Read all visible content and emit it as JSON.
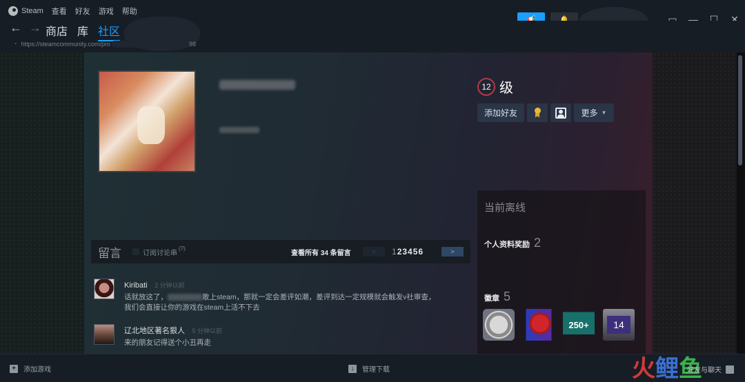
{
  "titlebar": {
    "app_name": "Steam",
    "menu": [
      "查看",
      "好友",
      "游戏",
      "帮助"
    ],
    "announce_icon": "megaphone-icon",
    "bell_icon": "bell-icon",
    "window_controls": {
      "big_picture": "▭",
      "minimize": "—",
      "maximize": "☐",
      "close": "✕"
    }
  },
  "nav": {
    "back": "←",
    "forward": "→",
    "tabs": [
      {
        "label": "商店",
        "active": false
      },
      {
        "label": "库",
        "active": false
      },
      {
        "label": "社区",
        "active": true
      }
    ],
    "url_prefix": "https://steamcommunity.com/pro",
    "url_suffix": "98"
  },
  "profile": {
    "level": "12",
    "level_label": "级",
    "buttons": {
      "add_friend": "添加好友",
      "more": "更多",
      "more_caret": "▼"
    },
    "status": "当前离线",
    "rewards_label": "个人资料奖励",
    "rewards_count": "2",
    "badges_label": "徽章",
    "badges_count": "5",
    "badges": [
      {
        "name": "silver-coin-badge",
        "text": ""
      },
      {
        "name": "red-seal-badge",
        "text": ""
      },
      {
        "name": "reviews-250-badge",
        "text": "250+"
      },
      {
        "name": "years-of-service-badge",
        "text": "14"
      }
    ]
  },
  "comments": {
    "title": "留言",
    "subscribe_label": "订阅讨论串",
    "help": "(?)",
    "view_all": "查看所有 34 条留言",
    "pager_prev": "<",
    "current_page": "1",
    "other_pages": "23456",
    "pager_next": ">",
    "items": [
      {
        "author": "Kiribati",
        "time": "2 分钟以前",
        "text_before": "话就放这了，",
        "text_after": "敢上steam，那就一定会差评如潮，差评到达一定规模就会触发v社审查，",
        "text_line2": "我们会直接让你的游戏在steam上活不下去"
      },
      {
        "author": "辽北地区著名狠人",
        "time": "5 分钟以前",
        "text_before": "来的朋友记得送个小丑再走",
        "text_after": "",
        "text_line2": ""
      }
    ]
  },
  "bottombar": {
    "add_game": "添加游戏",
    "manage_downloads": "管理下载",
    "friends_chat": "好友与聊天",
    "watermark": [
      "火",
      "鲤",
      "鱼"
    ]
  },
  "colors": {
    "accent": "#1a9fff",
    "level_ring": "#b23a48",
    "background": "#171d25"
  }
}
